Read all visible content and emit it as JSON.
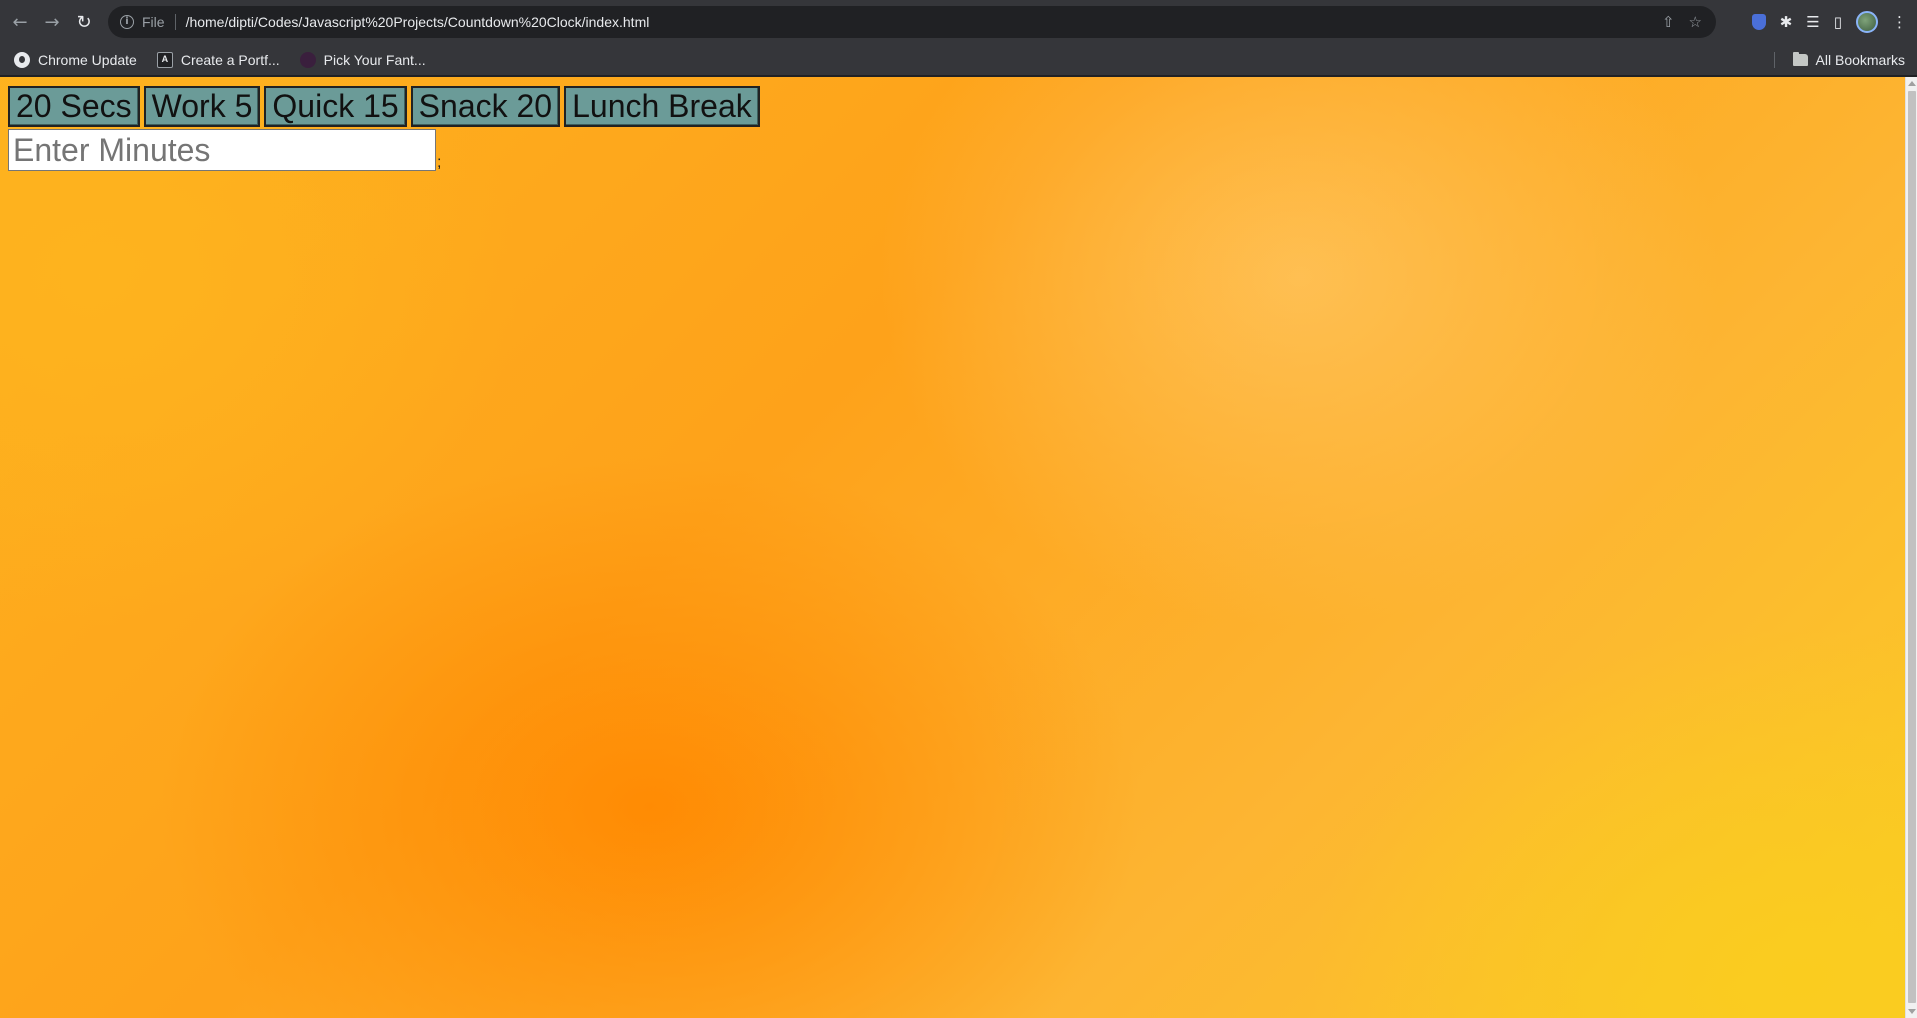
{
  "browser": {
    "address_scheme": "File",
    "url": "/home/dipti/Codes/Javascript%20Projects/Countdown%20Clock/index.html"
  },
  "icons": {
    "back": "←",
    "forward": "→",
    "reload": "↻",
    "info": "i",
    "share": "⇧",
    "star": "☆",
    "puzzle": "✱",
    "reading_list": "☰",
    "side_panel": "▯",
    "menu": "⋮"
  },
  "bookmarks": {
    "items": [
      {
        "label": "Chrome Update",
        "icon": "github-icon"
      },
      {
        "label": "Create a Portf...",
        "icon": "angular-icon"
      },
      {
        "label": "Pick Your Fant...",
        "icon": "font-icon"
      }
    ],
    "all_bookmarks_label": "All Bookmarks"
  },
  "page": {
    "timer_buttons": [
      {
        "label": "20 Secs"
      },
      {
        "label": "Work 5"
      },
      {
        "label": "Quick 15"
      },
      {
        "label": "Snack 20"
      },
      {
        "label": "Lunch Break"
      }
    ],
    "minutes_input": {
      "placeholder": "Enter Minutes",
      "value": ""
    },
    "trailing_text": ";"
  },
  "colors": {
    "button_bg": "#6b9b98",
    "background_orange": "#fea21a",
    "background_yellow": "#facb25"
  }
}
